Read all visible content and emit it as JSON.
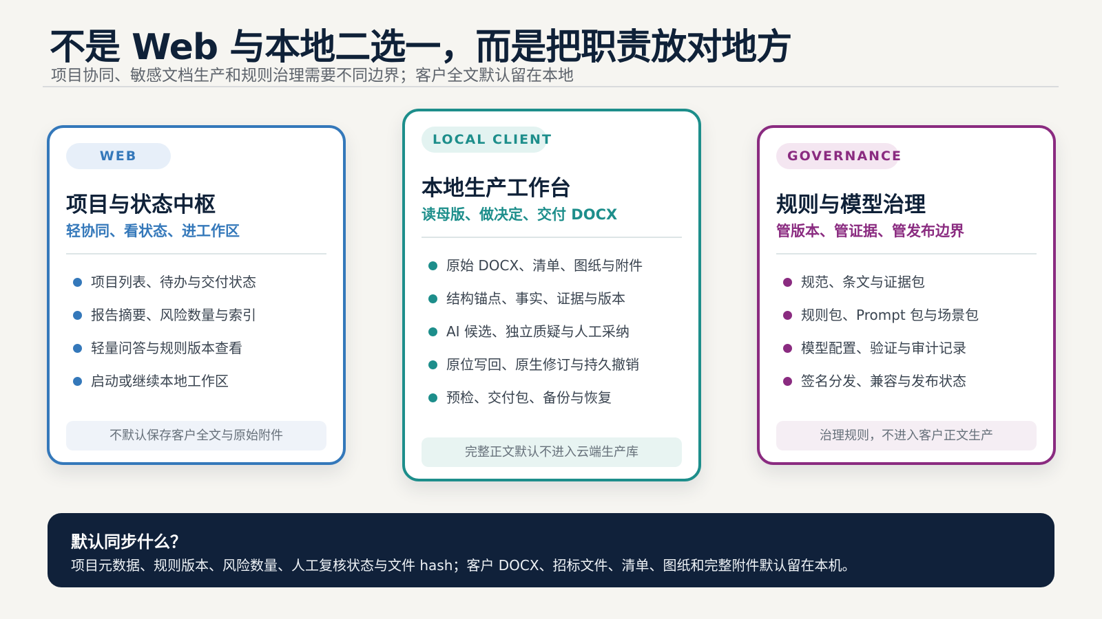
{
  "header": {
    "title": "不是 Web 与本地二选一，而是把职责放对地方",
    "subtitle": "项目协同、敏感文档生产和规则治理需要不同边界；客户全文默认留在本地"
  },
  "cards": [
    {
      "tag": "WEB",
      "title": "项目与状态中枢",
      "subtitle": "轻协同、看状态、进工作区",
      "items": [
        "项目列表、待办与交付状态",
        "报告摘要、风险数量与索引",
        "轻量问答与规则版本查看",
        "启动或继续本地工作区"
      ],
      "note": "不默认保存客户全文与原始附件",
      "accent": "#3478ba"
    },
    {
      "tag": "LOCAL CLIENT",
      "title": "本地生产工作台",
      "subtitle": "读母版、做决定、交付 DOCX",
      "items": [
        "原始 DOCX、清单、图纸与附件",
        "结构锚点、事实、证据与版本",
        "AI 候选、独立质疑与人工采纳",
        "原位写回、原生修订与持久撤销",
        "预检、交付包、备份与恢复"
      ],
      "note": "完整正文默认不进入云端生产库",
      "accent": "#1d8e8b"
    },
    {
      "tag": "GOVERNANCE",
      "title": "规则与模型治理",
      "subtitle": "管版本、管证据、管发布边界",
      "items": [
        "规范、条文与证据包",
        "规则包、Prompt 包与场景包",
        "模型配置、验证与审计记录",
        "签名分发、兼容与发布状态"
      ],
      "note": "治理规则，不进入客户正文生产",
      "accent": "#8a2b80"
    }
  ],
  "banner": {
    "title": "默认同步什么？",
    "text": "项目元数据、规则版本、风险数量、人工复核状态与文件 hash；客户 DOCX、招标文件、清单、图纸和完整附件默认留在本机。"
  }
}
